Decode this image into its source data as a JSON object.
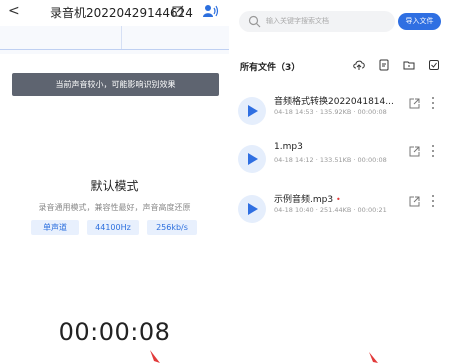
{
  "recorder": {
    "back_glyph": "<",
    "title": "录音机20220429144624",
    "hint": "当前声音较小，可能影响识别效果",
    "mode_title": "默认模式",
    "mode_desc": "录音通用模式，兼容性最好，声音高度还原",
    "chips": [
      "单声道",
      "44100Hz",
      "256kb/s"
    ],
    "timer": "00:00:08",
    "accent_color": "#2c6fde"
  },
  "files": {
    "search_placeholder": "输入关键字搜索文档",
    "import_label": "导入文件",
    "all_files_label": "所有文件（3）",
    "items": [
      {
        "name": "音频格式转换2022041814...",
        "meta": "04-18 14:53 · 135.92KB · 00:00:08",
        "new": ""
      },
      {
        "name": "1.mp3",
        "meta": "04-18 14:12 · 133.51KB · 00:00:08",
        "new": ""
      },
      {
        "name": "示例音频.mp3",
        "meta": "04-18 10:40 · 251.44KB · 00:00:21",
        "new": "•"
      }
    ],
    "accent_color": "#2f6fe2"
  }
}
